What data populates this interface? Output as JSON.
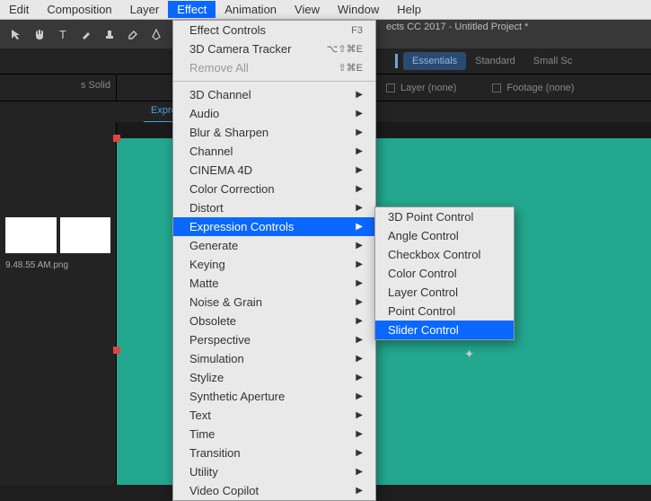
{
  "menubar": [
    "Edit",
    "Composition",
    "Layer",
    "Effect",
    "Animation",
    "View",
    "Window",
    "Help"
  ],
  "menubar_active_index": 3,
  "title": "ects CC 2017 - Untitled Project *",
  "workspace": {
    "items": [
      "Essentials",
      "Standard",
      "Small Sc"
    ],
    "active_index": 0
  },
  "left_panel_label": "s Solid",
  "layer_label": "Layer (none)",
  "footage_label": "Footage (none)",
  "tab_label": "Express",
  "thumb_filename": "9.48.55 AM.png",
  "effect_menu": {
    "top": [
      {
        "label": "Effect Controls",
        "shortcut": "F3"
      },
      {
        "label": "3D Camera Tracker",
        "shortcut": "⌥⇧⌘E"
      },
      {
        "label": "Remove All",
        "shortcut": "⇧⌘E",
        "disabled": true
      }
    ],
    "categories": [
      "3D Channel",
      "Audio",
      "Blur & Sharpen",
      "Channel",
      "CINEMA 4D",
      "Color Correction",
      "Distort",
      "Expression Controls",
      "Generate",
      "Keying",
      "Matte",
      "Noise & Grain",
      "Obsolete",
      "Perspective",
      "Simulation",
      "Stylize",
      "Synthetic Aperture",
      "Text",
      "Time",
      "Transition",
      "Utility",
      "Video Copilot"
    ],
    "hover_index": 7
  },
  "submenu": {
    "items": [
      "3D Point Control",
      "Angle Control",
      "Checkbox Control",
      "Color Control",
      "Layer Control",
      "Point Control",
      "Slider Control"
    ],
    "hover_index": 6
  },
  "tool_icons": [
    "pointer-icon",
    "hand-icon",
    "text-icon",
    "brush-icon",
    "stamp-icon",
    "eraser-icon",
    "pen-icon",
    "shape-icon"
  ]
}
